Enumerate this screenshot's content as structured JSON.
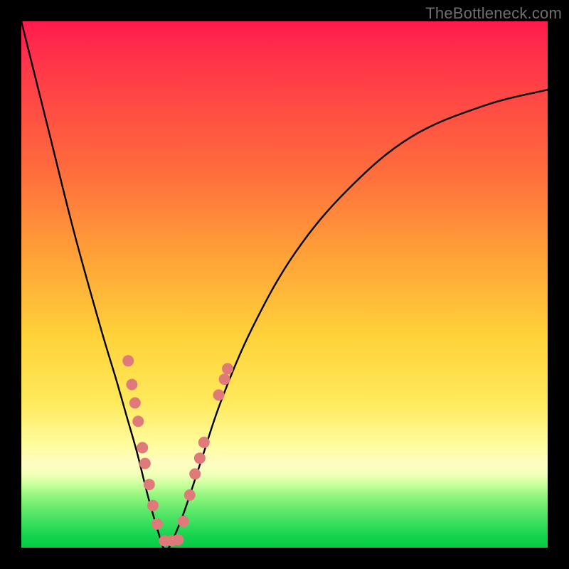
{
  "watermark": "TheBottleneck.com",
  "chart_data": {
    "type": "line",
    "title": "",
    "xlabel": "",
    "ylabel": "",
    "xlim": [
      0,
      100
    ],
    "ylim": [
      0,
      100
    ],
    "grid": false,
    "description": "V-shaped bottleneck curve over a vertical red-to-green gradient; minimum of curve sits near x≈27 at the green bottom band. Pink dot markers cluster along both flanks of the V in the lower (yellow/green) region.",
    "series": [
      {
        "name": "bottleneck-curve",
        "color": "#000000",
        "x": [
          0,
          5,
          10,
          15,
          18,
          20,
          22,
          24,
          26,
          27,
          28,
          29,
          31,
          34,
          38,
          44,
          52,
          62,
          74,
          88,
          100
        ],
        "y": [
          100,
          80,
          60,
          42,
          32,
          25,
          18,
          10,
          3,
          0,
          0,
          2,
          7,
          16,
          28,
          42,
          56,
          68,
          78,
          84,
          87
        ]
      }
    ],
    "markers": {
      "name": "sample-points",
      "color": "#e07a7a",
      "radius": 8,
      "points": [
        {
          "x": 20.3,
          "y": 35.5
        },
        {
          "x": 21.0,
          "y": 31.0
        },
        {
          "x": 21.6,
          "y": 27.5
        },
        {
          "x": 22.2,
          "y": 24.0
        },
        {
          "x": 23.0,
          "y": 19.0
        },
        {
          "x": 23.5,
          "y": 16.0
        },
        {
          "x": 24.3,
          "y": 12.0
        },
        {
          "x": 25.0,
          "y": 8.0
        },
        {
          "x": 25.8,
          "y": 4.5
        },
        {
          "x": 27.2,
          "y": 1.3
        },
        {
          "x": 28.6,
          "y": 1.3
        },
        {
          "x": 29.8,
          "y": 1.5
        },
        {
          "x": 30.8,
          "y": 5.0
        },
        {
          "x": 32.0,
          "y": 10.0
        },
        {
          "x": 33.0,
          "y": 14.0
        },
        {
          "x": 33.9,
          "y": 17.0
        },
        {
          "x": 34.7,
          "y": 20.0
        },
        {
          "x": 37.5,
          "y": 29.0
        },
        {
          "x": 38.6,
          "y": 32.0
        },
        {
          "x": 39.2,
          "y": 34.0
        }
      ]
    }
  }
}
